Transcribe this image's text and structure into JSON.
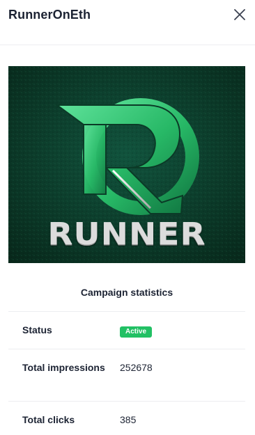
{
  "header": {
    "title": "RunnerOnEth",
    "close_icon": "close-icon"
  },
  "banner": {
    "logo_text": "RUNNER",
    "background_color": "#0d3a2c",
    "accent_color": "#2ecc71"
  },
  "stats": {
    "title": "Campaign statistics",
    "rows": [
      {
        "label": "Status",
        "value": "Active",
        "badge_color": "#22c064"
      },
      {
        "label": "Total impressions",
        "value": "252678"
      },
      {
        "label": "Total clicks",
        "value": "385"
      }
    ]
  }
}
